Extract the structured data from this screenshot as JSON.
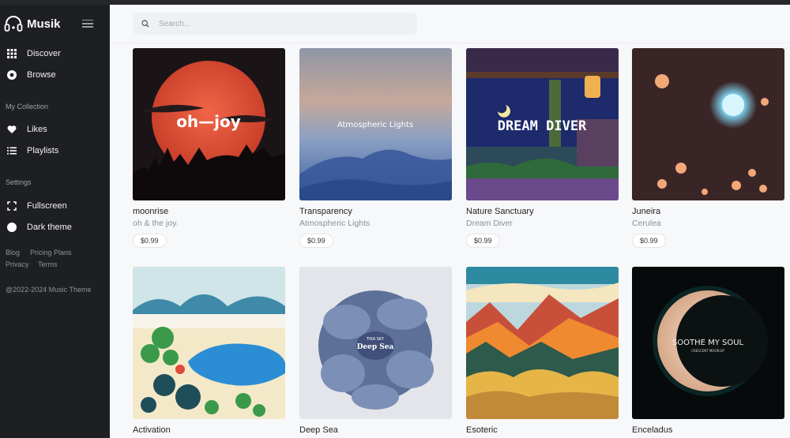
{
  "app": {
    "name": "Musik"
  },
  "sidebar": {
    "items": [
      {
        "label": "Discover",
        "icon": "grid-icon"
      },
      {
        "label": "Browse",
        "icon": "radio-icon"
      }
    ],
    "collection_title": "My Collection",
    "collection": [
      {
        "label": "Likes",
        "icon": "heart-icon"
      },
      {
        "label": "Playlists",
        "icon": "list-icon"
      }
    ],
    "settings_title": "Settings",
    "settings": [
      {
        "label": "Fullscreen",
        "icon": "fullscreen-icon"
      },
      {
        "label": "Dark theme",
        "icon": "toggle-icon"
      }
    ],
    "links": [
      "Blog",
      "Pricing Plans",
      "Privacy",
      "Terms"
    ],
    "copyright": "@2022-2024 Music Theme"
  },
  "search": {
    "placeholder": "Search..."
  },
  "albums": [
    {
      "title": "moonrise",
      "artist": "oh & the joy.",
      "price": "$0.99",
      "cover_text": "oh—joy"
    },
    {
      "title": "Transparency",
      "artist": "Atmospheric Lights",
      "price": "$0.99",
      "cover_text": "Atmospheric Lights"
    },
    {
      "title": "Nature Sanctuary",
      "artist": "Dream Diver",
      "price": "$0.99",
      "cover_text": "DREAM DIVER"
    },
    {
      "title": "Juneira",
      "artist": "Cerulea",
      "price": "$0.99"
    },
    {
      "title": "Activation"
    },
    {
      "title": "Deep Sea",
      "cover_text": "Deep Sea",
      "cover_small": "TIKA SKY"
    },
    {
      "title": "Esoteric"
    },
    {
      "title": "Enceladus",
      "cover_text": "SOOTHE MY SOUL",
      "cover_small": "CRESCENT MOON EP"
    }
  ],
  "colors": {
    "sidebar_bg": "#1e1f22",
    "main_bg": "#f7f8fa",
    "search_bg": "#eef0f3"
  }
}
